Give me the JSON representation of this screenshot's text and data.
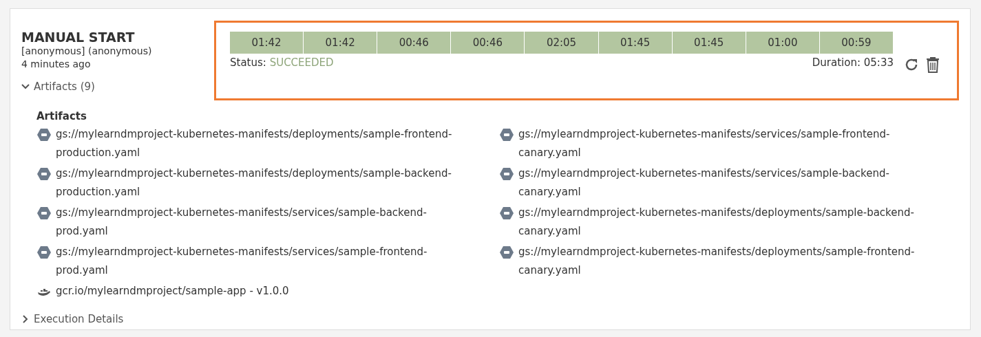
{
  "execution": {
    "title": "MANUAL START",
    "trigger": "[anonymous] (anonymous)",
    "time": "4 minutes ago",
    "stages": [
      "01:42",
      "01:42",
      "00:46",
      "00:46",
      "02:05",
      "01:45",
      "01:45",
      "01:00",
      "00:59"
    ],
    "status_label": "Status:",
    "status": "SUCCEEDED",
    "duration": "Duration: 05:33",
    "highlighted": true
  },
  "artifacts_toggle": {
    "label": "Artifacts (9)",
    "expanded": true
  },
  "artifacts": {
    "heading": "Artifacts",
    "items": [
      {
        "kind": "gcs",
        "text": "gs://mylearndmproject-kubernetes-manifests/deployments/sample-frontend-production.yaml"
      },
      {
        "kind": "gcs",
        "text": "gs://mylearndmproject-kubernetes-manifests/services/sample-frontend-canary.yaml"
      },
      {
        "kind": "gcs",
        "text": "gs://mylearndmproject-kubernetes-manifests/deployments/sample-backend-production.yaml"
      },
      {
        "kind": "gcs",
        "text": "gs://mylearndmproject-kubernetes-manifests/services/sample-backend-canary.yaml"
      },
      {
        "kind": "gcs",
        "text": "gs://mylearndmproject-kubernetes-manifests/services/sample-backend-prod.yaml"
      },
      {
        "kind": "gcs",
        "text": "gs://mylearndmproject-kubernetes-manifests/deployments/sample-backend-canary.yaml"
      },
      {
        "kind": "gcs",
        "text": "gs://mylearndmproject-kubernetes-manifests/services/sample-frontend-prod.yaml"
      },
      {
        "kind": "gcs",
        "text": "gs://mylearndmproject-kubernetes-manifests/deployments/sample-frontend-canary.yaml"
      },
      {
        "kind": "docker",
        "text": "gcr.io/mylearndmproject/sample-app - v1.0.0"
      }
    ]
  },
  "details_toggle": {
    "label": "Execution Details",
    "expanded": false
  }
}
